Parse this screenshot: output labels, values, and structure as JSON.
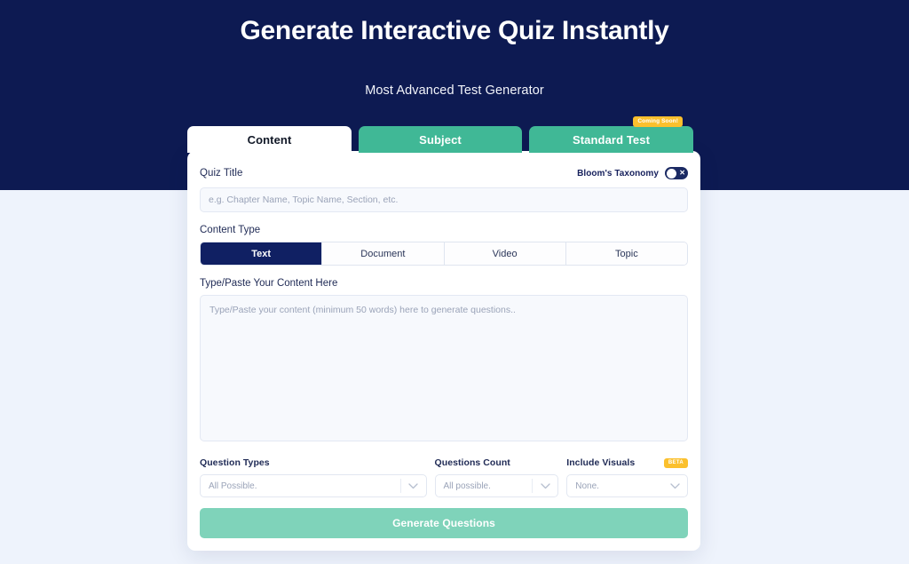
{
  "hero": {
    "title": "Generate Interactive Quiz Instantly",
    "subtitle": "Most Advanced Test Generator",
    "bg_color": "#0d1a52"
  },
  "tabs": [
    {
      "label": "Content",
      "active": true
    },
    {
      "label": "Subject",
      "active": false
    },
    {
      "label": "Standard Test",
      "active": false,
      "badge": "Coming Soon!"
    }
  ],
  "tab_badge": {
    "text": "Coming Soon!",
    "color": "#fbc02d"
  },
  "form": {
    "quiz_title": {
      "label": "Quiz Title",
      "value": "",
      "placeholder": "e.g. Chapter Name, Topic Name, Section, etc."
    },
    "blooms_taxonomy": {
      "label": "Bloom's Taxonomy",
      "enabled": false,
      "off_glyph": "✕"
    },
    "content_type": {
      "label": "Content Type",
      "options": [
        "Text",
        "Document",
        "Video",
        "Topic"
      ],
      "selected": "Text"
    },
    "content_body": {
      "label": "Type/Paste Your Content Here",
      "value": "",
      "placeholder": "Type/Paste your content (minimum 50 words) here to generate questions.."
    },
    "question_types": {
      "label": "Question Types",
      "value": "All Possible."
    },
    "questions_count": {
      "label": "Questions Count",
      "value": "All possible."
    },
    "include_visuals": {
      "label": "Include Visuals",
      "value": "None.",
      "badge": "BETA"
    },
    "submit": {
      "label": "Generate Questions",
      "color": "#7fd3ba"
    }
  },
  "theme": {
    "navy": "#0d1a52",
    "navy_active": "#102063",
    "teal": "#40b896",
    "teal_light": "#7fd3ba",
    "yellow": "#fbc02d",
    "page_bg": "#eef3fc"
  }
}
